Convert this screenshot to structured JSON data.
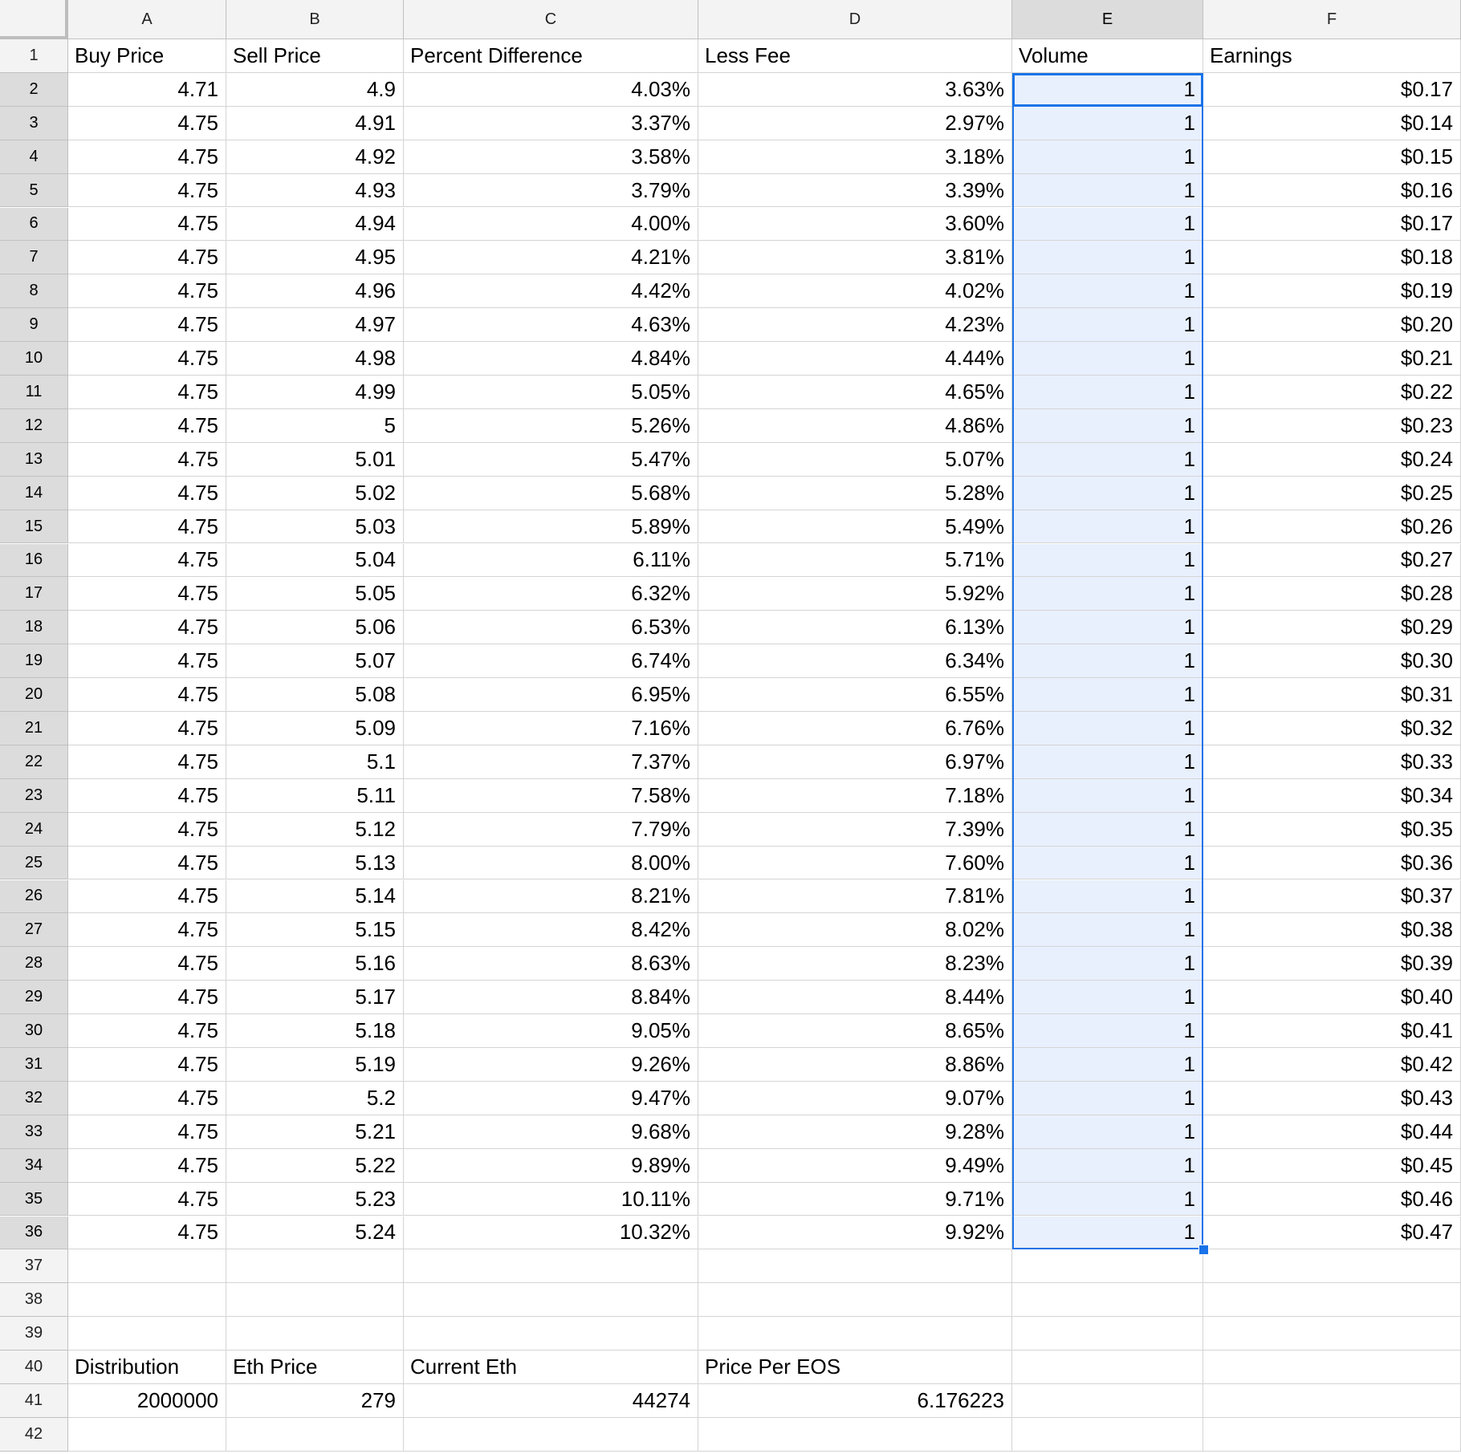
{
  "sheet": {
    "columns": [
      "A",
      "B",
      "C",
      "D",
      "E",
      "F"
    ],
    "selected_column": "E",
    "selected_range": "E2:E36",
    "active_cell": "E2",
    "rows": [
      {
        "n": 1,
        "cells": [
          "Buy Price",
          "Sell Price",
          "Percent Difference",
          "Less Fee",
          "Volume",
          "Earnings"
        ]
      },
      {
        "n": 2,
        "cells": [
          "4.71",
          "4.9",
          "4.03%",
          "3.63%",
          "1",
          "$0.17"
        ]
      },
      {
        "n": 3,
        "cells": [
          "4.75",
          "4.91",
          "3.37%",
          "2.97%",
          "1",
          "$0.14"
        ]
      },
      {
        "n": 4,
        "cells": [
          "4.75",
          "4.92",
          "3.58%",
          "3.18%",
          "1",
          "$0.15"
        ]
      },
      {
        "n": 5,
        "cells": [
          "4.75",
          "4.93",
          "3.79%",
          "3.39%",
          "1",
          "$0.16"
        ]
      },
      {
        "n": 6,
        "cells": [
          "4.75",
          "4.94",
          "4.00%",
          "3.60%",
          "1",
          "$0.17"
        ]
      },
      {
        "n": 7,
        "cells": [
          "4.75",
          "4.95",
          "4.21%",
          "3.81%",
          "1",
          "$0.18"
        ]
      },
      {
        "n": 8,
        "cells": [
          "4.75",
          "4.96",
          "4.42%",
          "4.02%",
          "1",
          "$0.19"
        ]
      },
      {
        "n": 9,
        "cells": [
          "4.75",
          "4.97",
          "4.63%",
          "4.23%",
          "1",
          "$0.20"
        ]
      },
      {
        "n": 10,
        "cells": [
          "4.75",
          "4.98",
          "4.84%",
          "4.44%",
          "1",
          "$0.21"
        ]
      },
      {
        "n": 11,
        "cells": [
          "4.75",
          "4.99",
          "5.05%",
          "4.65%",
          "1",
          "$0.22"
        ]
      },
      {
        "n": 12,
        "cells": [
          "4.75",
          "5",
          "5.26%",
          "4.86%",
          "1",
          "$0.23"
        ]
      },
      {
        "n": 13,
        "cells": [
          "4.75",
          "5.01",
          "5.47%",
          "5.07%",
          "1",
          "$0.24"
        ]
      },
      {
        "n": 14,
        "cells": [
          "4.75",
          "5.02",
          "5.68%",
          "5.28%",
          "1",
          "$0.25"
        ]
      },
      {
        "n": 15,
        "cells": [
          "4.75",
          "5.03",
          "5.89%",
          "5.49%",
          "1",
          "$0.26"
        ]
      },
      {
        "n": 16,
        "cells": [
          "4.75",
          "5.04",
          "6.11%",
          "5.71%",
          "1",
          "$0.27"
        ]
      },
      {
        "n": 17,
        "cells": [
          "4.75",
          "5.05",
          "6.32%",
          "5.92%",
          "1",
          "$0.28"
        ]
      },
      {
        "n": 18,
        "cells": [
          "4.75",
          "5.06",
          "6.53%",
          "6.13%",
          "1",
          "$0.29"
        ]
      },
      {
        "n": 19,
        "cells": [
          "4.75",
          "5.07",
          "6.74%",
          "6.34%",
          "1",
          "$0.30"
        ]
      },
      {
        "n": 20,
        "cells": [
          "4.75",
          "5.08",
          "6.95%",
          "6.55%",
          "1",
          "$0.31"
        ]
      },
      {
        "n": 21,
        "cells": [
          "4.75",
          "5.09",
          "7.16%",
          "6.76%",
          "1",
          "$0.32"
        ]
      },
      {
        "n": 22,
        "cells": [
          "4.75",
          "5.1",
          "7.37%",
          "6.97%",
          "1",
          "$0.33"
        ]
      },
      {
        "n": 23,
        "cells": [
          "4.75",
          "5.11",
          "7.58%",
          "7.18%",
          "1",
          "$0.34"
        ]
      },
      {
        "n": 24,
        "cells": [
          "4.75",
          "5.12",
          "7.79%",
          "7.39%",
          "1",
          "$0.35"
        ]
      },
      {
        "n": 25,
        "cells": [
          "4.75",
          "5.13",
          "8.00%",
          "7.60%",
          "1",
          "$0.36"
        ]
      },
      {
        "n": 26,
        "cells": [
          "4.75",
          "5.14",
          "8.21%",
          "7.81%",
          "1",
          "$0.37"
        ]
      },
      {
        "n": 27,
        "cells": [
          "4.75",
          "5.15",
          "8.42%",
          "8.02%",
          "1",
          "$0.38"
        ]
      },
      {
        "n": 28,
        "cells": [
          "4.75",
          "5.16",
          "8.63%",
          "8.23%",
          "1",
          "$0.39"
        ]
      },
      {
        "n": 29,
        "cells": [
          "4.75",
          "5.17",
          "8.84%",
          "8.44%",
          "1",
          "$0.40"
        ]
      },
      {
        "n": 30,
        "cells": [
          "4.75",
          "5.18",
          "9.05%",
          "8.65%",
          "1",
          "$0.41"
        ]
      },
      {
        "n": 31,
        "cells": [
          "4.75",
          "5.19",
          "9.26%",
          "8.86%",
          "1",
          "$0.42"
        ]
      },
      {
        "n": 32,
        "cells": [
          "4.75",
          "5.2",
          "9.47%",
          "9.07%",
          "1",
          "$0.43"
        ]
      },
      {
        "n": 33,
        "cells": [
          "4.75",
          "5.21",
          "9.68%",
          "9.28%",
          "1",
          "$0.44"
        ]
      },
      {
        "n": 34,
        "cells": [
          "4.75",
          "5.22",
          "9.89%",
          "9.49%",
          "1",
          "$0.45"
        ]
      },
      {
        "n": 35,
        "cells": [
          "4.75",
          "5.23",
          "10.11%",
          "9.71%",
          "1",
          "$0.46"
        ]
      },
      {
        "n": 36,
        "cells": [
          "4.75",
          "5.24",
          "10.32%",
          "9.92%",
          "1",
          "$0.47"
        ]
      },
      {
        "n": 37,
        "cells": [
          "",
          "",
          "",
          "",
          "",
          ""
        ]
      },
      {
        "n": 38,
        "cells": [
          "",
          "",
          "",
          "",
          "",
          ""
        ]
      },
      {
        "n": 39,
        "cells": [
          "",
          "",
          "",
          "",
          "",
          ""
        ]
      },
      {
        "n": 40,
        "cells": [
          "Distribution",
          "Eth Price",
          "Current Eth",
          "Price Per EOS",
          "",
          ""
        ]
      },
      {
        "n": 41,
        "cells": [
          "2000000",
          "279",
          "44274",
          "6.176223",
          "",
          ""
        ]
      },
      {
        "n": 42,
        "cells": [
          "",
          "",
          "",
          "",
          "",
          ""
        ]
      }
    ]
  },
  "colors": {
    "selection_border": "#1a73e8",
    "selection_fill": "#e8f0fe",
    "header_bg": "#f3f3f3",
    "header_selected_bg": "#dcdcdc",
    "gridline": "#d4d4d4"
  }
}
